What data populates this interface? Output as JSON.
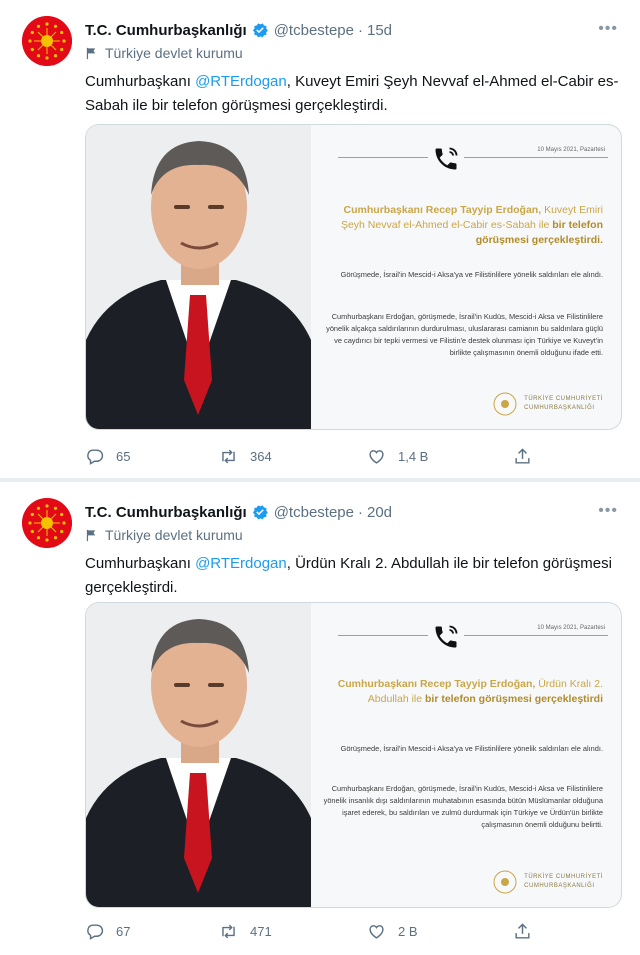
{
  "tweets": [
    {
      "account_name": "T.C. Cumhurbaşkanlığı",
      "handle": "@tcbestepe",
      "separator": "·",
      "time": "15d",
      "label": "Türkiye devlet kurumu",
      "text_prefix": "Cumhurbaşkanı ",
      "mention": "@RTErdogan",
      "text_suffix": ", Kuveyt Emiri Şeyh Nevvaf el-Ahmed el-Cabir es-Sabah ile bir telefon görüşmesi gerçekleştirdi.",
      "card": {
        "date": "10 Mayıs 2021, Pazartesi",
        "headline_a": "Cumhurbaşkanı Recep Tayyip Erdoğan,",
        "headline_b": "Kuveyt Emiri Şeyh Nevvaf el-Ahmed el-Cabir es-Sabah ile",
        "headline_c": "bir telefon görüşmesi gerçekleştirdi.",
        "para1": "Görüşmede, İsrail'in Mescid-i Aksa'ya ve Filistinlilere yönelik saldırıları ele alındı.",
        "para2": "Cumhurbaşkanı Erdoğan, görüşmede, İsrail'in Kudüs, Mescid-i Aksa ve Filistinlilere yönelik alçakça saldırılarının durdurulması, uluslararası camianın bu saldırılara güçlü ve caydırıcı bir tepki vermesi ve Filistin'e destek olunması için Türkiye ve Kuveyt'in birlikte çalışmasının önemli olduğunu ifade etti.",
        "logo_line1": "TÜRKİYE CUMHURİYETİ",
        "logo_line2": "CUMHURBAŞKANLIĞI"
      },
      "replies": "65",
      "retweets": "364",
      "likes": "1,4 B"
    },
    {
      "account_name": "T.C. Cumhurbaşkanlığı",
      "handle": "@tcbestepe",
      "separator": "·",
      "time": "20d",
      "label": "Türkiye devlet kurumu",
      "text_prefix": "Cumhurbaşkanı ",
      "mention": "@RTErdogan",
      "text_suffix": ", Ürdün Kralı 2. Abdullah ile bir telefon görüşmesi gerçekleştirdi.",
      "card": {
        "date": "10 Mayıs 2021, Pazartesi",
        "headline_a": "Cumhurbaşkanı Recep Tayyip Erdoğan,",
        "headline_b": "Ürdün Kralı 2. Abdullah ile",
        "headline_c": "bir telefon görüşmesi gerçekleştirdi",
        "para1": "Görüşmede, İsrail'in Mescid-i Aksa'ya ve Filistinlilere yönelik saldırıları ele alındı.",
        "para2": "Cumhurbaşkanı Erdoğan, görüşmede, İsrail'in Kudüs, Mescid-i Aksa ve Filistinlilere yönelik insanlık dışı saldırılarının muhatabının esasında bütün Müslümanlar olduğuna işaret ederek, bu saldırıları ve zulmü durdurmak için Türkiye ve Ürdün'ün birlikte çalışmasının önemli olduğunu belirtti.",
        "logo_line1": "TÜRKİYE CUMHURİYETİ",
        "logo_line2": "CUMHURBAŞKANLIĞI"
      },
      "replies": "67",
      "retweets": "471",
      "likes": "2 B"
    }
  ],
  "colors": {
    "accent": "#1d9bf0",
    "gold": "#c9a647",
    "avatar_red": "#e30a17",
    "muted": "#5b7083"
  },
  "icons": [
    "verified-icon",
    "flag-label-icon",
    "more-icon",
    "phone-icon",
    "reply-icon",
    "retweet-icon",
    "like-icon",
    "share-icon"
  ]
}
